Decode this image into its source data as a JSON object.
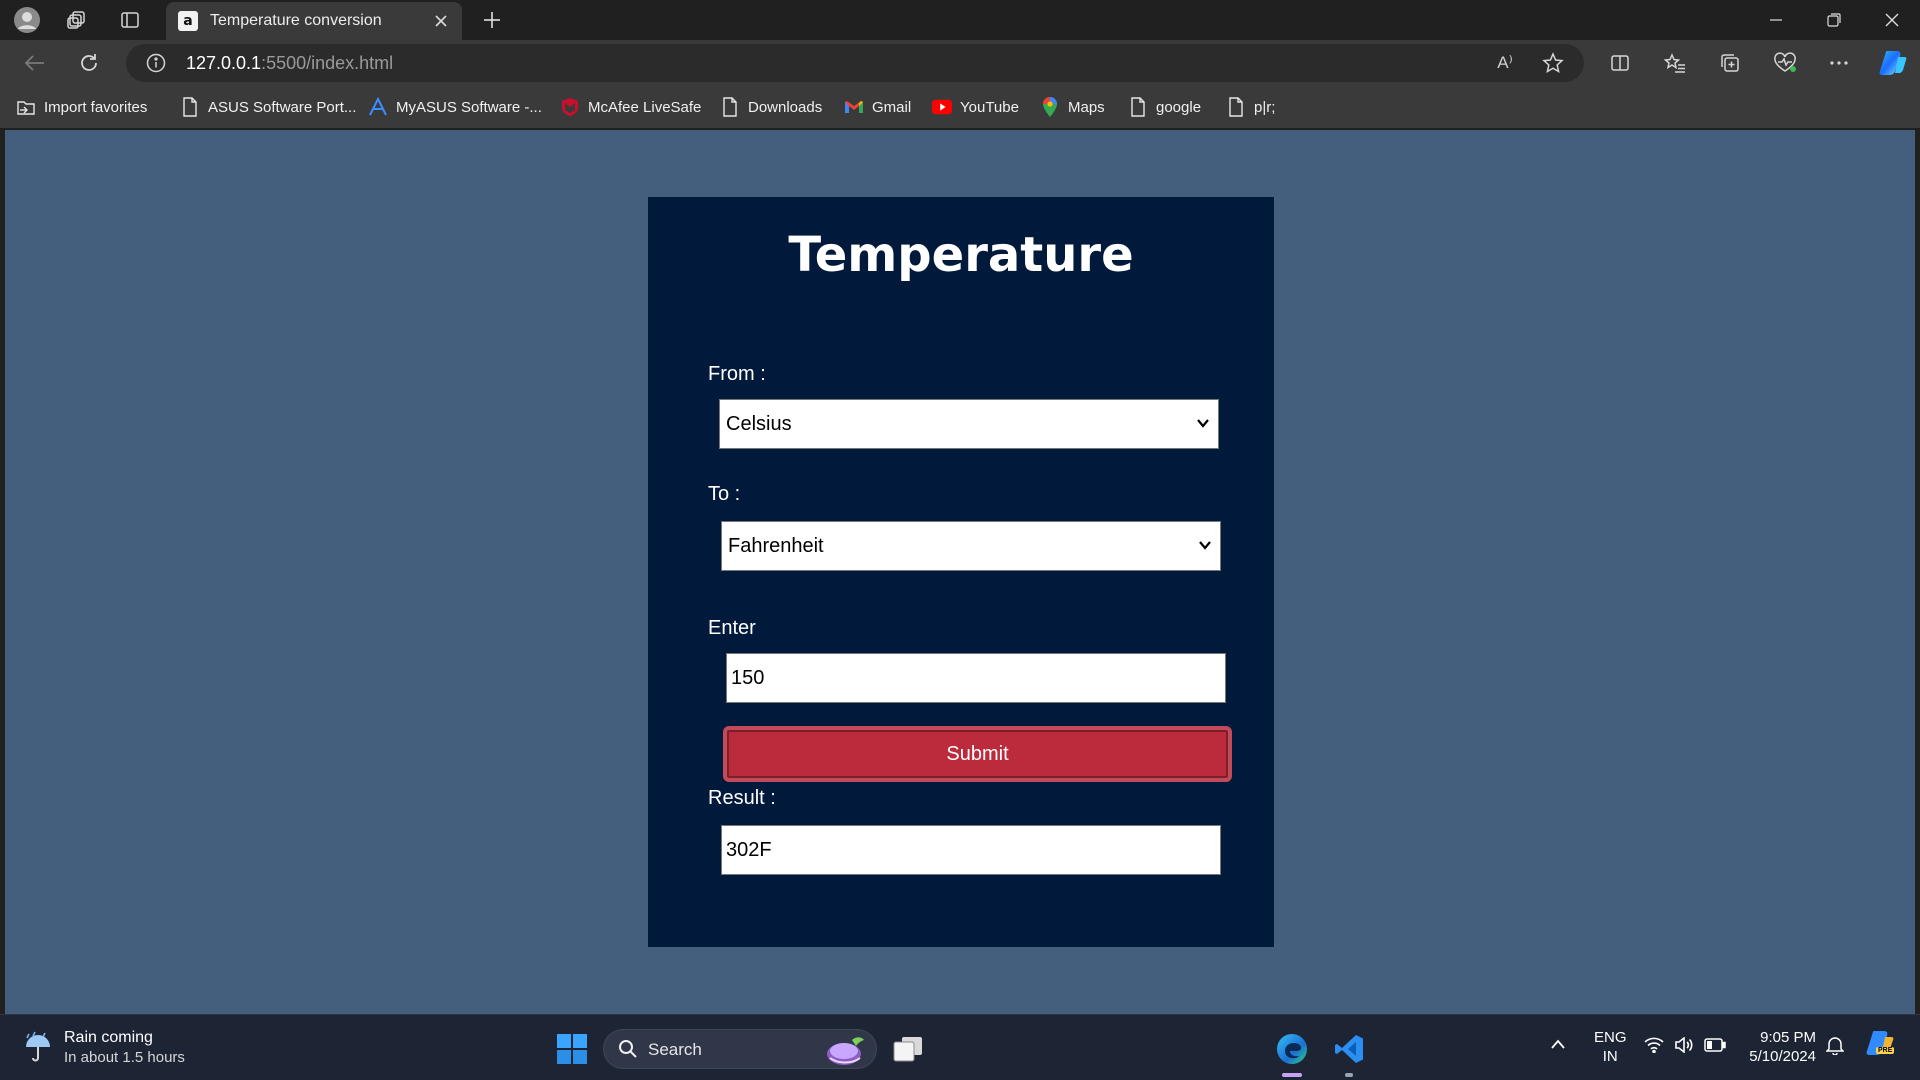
{
  "browser": {
    "tab_title": "Temperature conversion",
    "tab_favicon_letter": "a",
    "url_host": "127.0.0.1",
    "url_rest": ":5500/index.html",
    "read_aloud_icon_text": "A⁾"
  },
  "favorites": [
    {
      "label": "Import favorites",
      "icon": "import-icon"
    },
    {
      "label": "ASUS Software Port...",
      "icon": "page-icon"
    },
    {
      "label": "MyASUS Software -...",
      "icon": "myasus-icon"
    },
    {
      "label": "McAfee LiveSafe",
      "icon": "mcafee-icon"
    },
    {
      "label": "Downloads",
      "icon": "page-icon"
    },
    {
      "label": "Gmail",
      "icon": "gmail-icon"
    },
    {
      "label": "YouTube",
      "icon": "youtube-icon"
    },
    {
      "label": "Maps",
      "icon": "maps-icon"
    },
    {
      "label": "google",
      "icon": "page-icon"
    },
    {
      "label": "p|r;",
      "icon": "page-icon"
    }
  ],
  "page": {
    "title": "Temperature",
    "from_label": "From :",
    "from_value": "Celsius",
    "to_label": "To :",
    "to_value": "Fahrenheit",
    "enter_label": "Enter",
    "enter_value": "150",
    "submit_label": "Submit",
    "result_label": "Result :",
    "result_value": "302F"
  },
  "taskbar": {
    "weather_title": "Rain coming",
    "weather_sub": "In about 1.5 hours",
    "search_placeholder": "Search",
    "lang_top": "ENG",
    "lang_bottom": "IN",
    "time": "9:05 PM",
    "date": "5/10/2024",
    "copilot_badge": "PRE"
  },
  "colors": {
    "page_background": "#445e7d",
    "card_background": "#011a3c",
    "submit_background": "#bb2b3b"
  }
}
